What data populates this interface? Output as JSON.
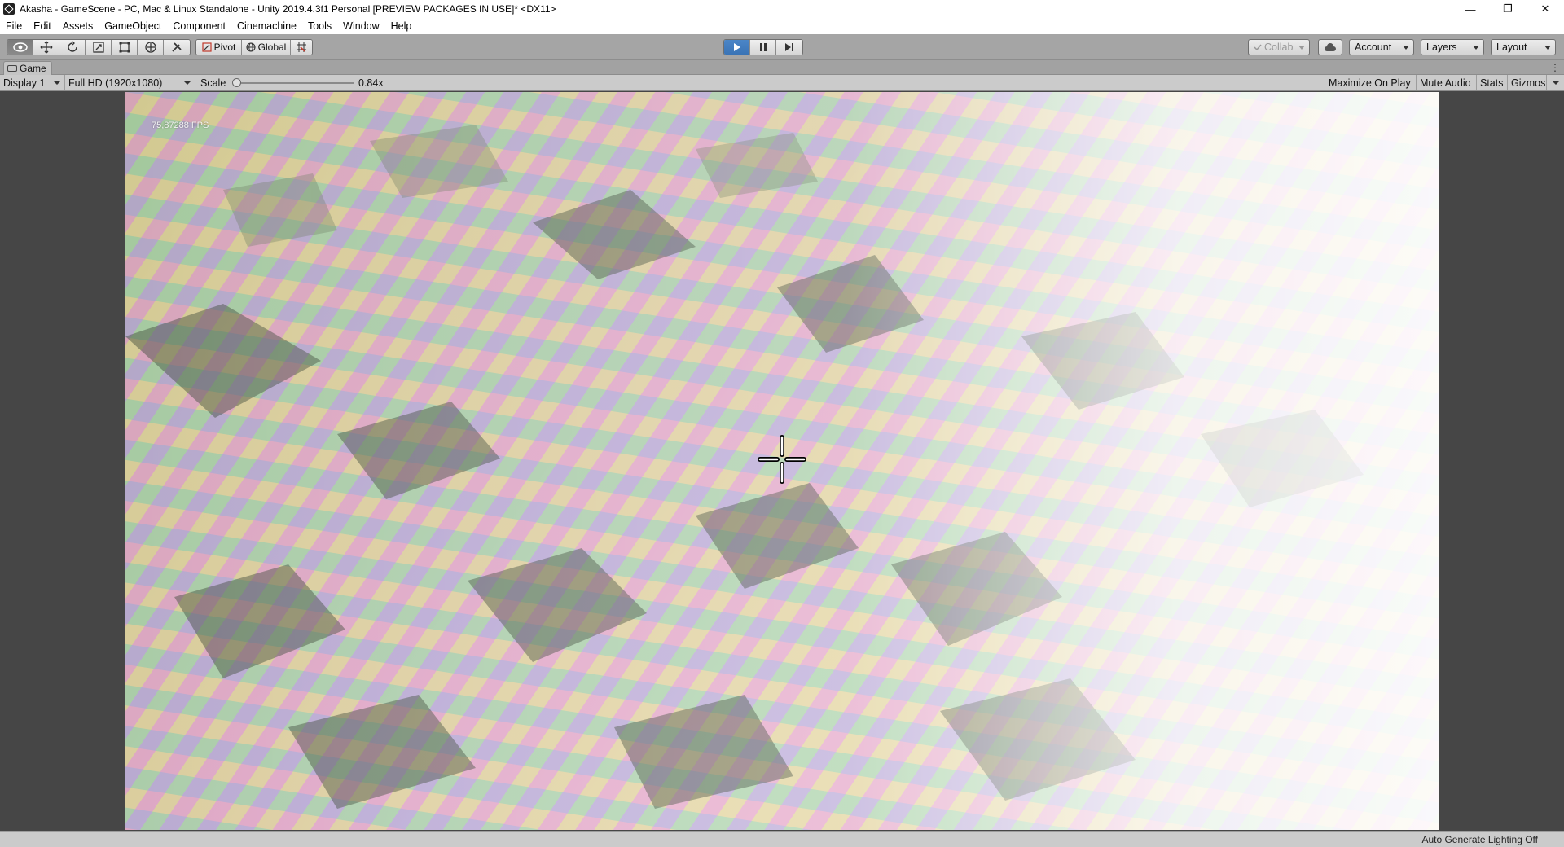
{
  "window": {
    "title": "Akasha - GameScene - PC, Mac & Linux Standalone - Unity 2019.4.3f1 Personal [PREVIEW PACKAGES IN USE]* <DX11>",
    "minimize_glyph": "—",
    "restore_glyph": "❐",
    "close_glyph": "✕"
  },
  "menu": {
    "items": [
      "File",
      "Edit",
      "Assets",
      "GameObject",
      "Component",
      "Cinemachine",
      "Tools",
      "Window",
      "Help"
    ]
  },
  "toolbar": {
    "tools": [
      "view-tool",
      "move-tool",
      "rotate-tool",
      "scale-tool",
      "rect-tool",
      "transform-tool",
      "custom-tool"
    ],
    "pivot_label": "Pivot",
    "global_label": "Global",
    "collab_label": "Collab",
    "account_label": "Account",
    "layers_label": "Layers",
    "layout_label": "Layout",
    "play_state": "playing"
  },
  "tabs": {
    "game_label": "Game"
  },
  "gamebar": {
    "display_label": "Display 1",
    "resolution_label": "Full HD (1920x1080)",
    "scale_label": "Scale",
    "scale_value": "0.84x",
    "scale_fraction": 0.0,
    "maximize_label": "Maximize On Play",
    "mute_label": "Mute Audio",
    "stats_label": "Stats",
    "gizmos_label": "Gizmos"
  },
  "viewport": {
    "fps_text": "75,87288 FPS"
  },
  "status": {
    "lighting_text": "Auto Generate Lighting Off"
  },
  "colors": {
    "accent_play": "#3a74b6",
    "toolbar_bg": "#a5a5a5",
    "viewport_bg": "#464646"
  }
}
